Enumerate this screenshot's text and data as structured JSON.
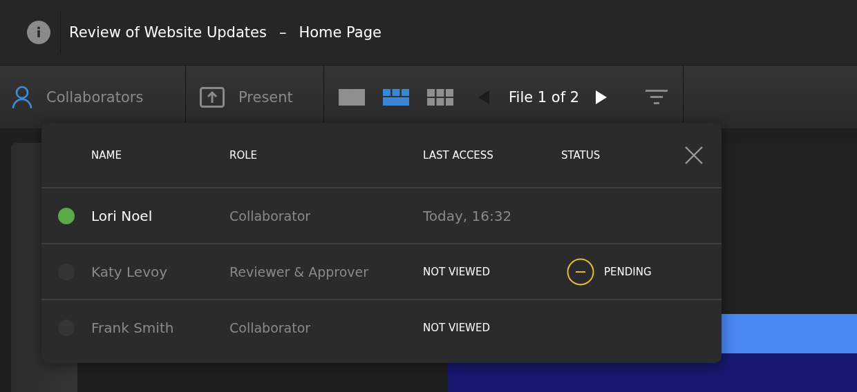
{
  "header": {
    "title": "Review of Website Updates",
    "separator": "–",
    "page": "Home Page"
  },
  "toolbar": {
    "collaborators": {
      "label": "Collaborators",
      "active": true
    },
    "present": {
      "label": "Present"
    },
    "view_modes": [
      {
        "kind": "single",
        "selected": false
      },
      {
        "kind": "strip",
        "selected": true
      },
      {
        "kind": "grid",
        "selected": false
      }
    ],
    "pager": {
      "label": "File 1 of 2",
      "prev_disabled": true,
      "next_disabled": false
    }
  },
  "collaborators_popup": {
    "columns": [
      "NAME",
      "ROLE",
      "LAST ACCESS",
      "STATUS"
    ],
    "rows": [
      {
        "online": true,
        "name": "Lori Noel",
        "role": "Collaborator",
        "last_access": "Today, 16:32",
        "viewed": true
      },
      {
        "online": false,
        "name": "Katy Levoy",
        "role": "Reviewer & Approver",
        "last_access": "NOT VIEWED",
        "viewed": false,
        "status": {
          "kind": "pending",
          "label": "PENDING"
        }
      },
      {
        "online": false,
        "name": "Frank Smith",
        "role": "Collaborator",
        "last_access": "NOT VIEWED",
        "viewed": false
      }
    ]
  }
}
